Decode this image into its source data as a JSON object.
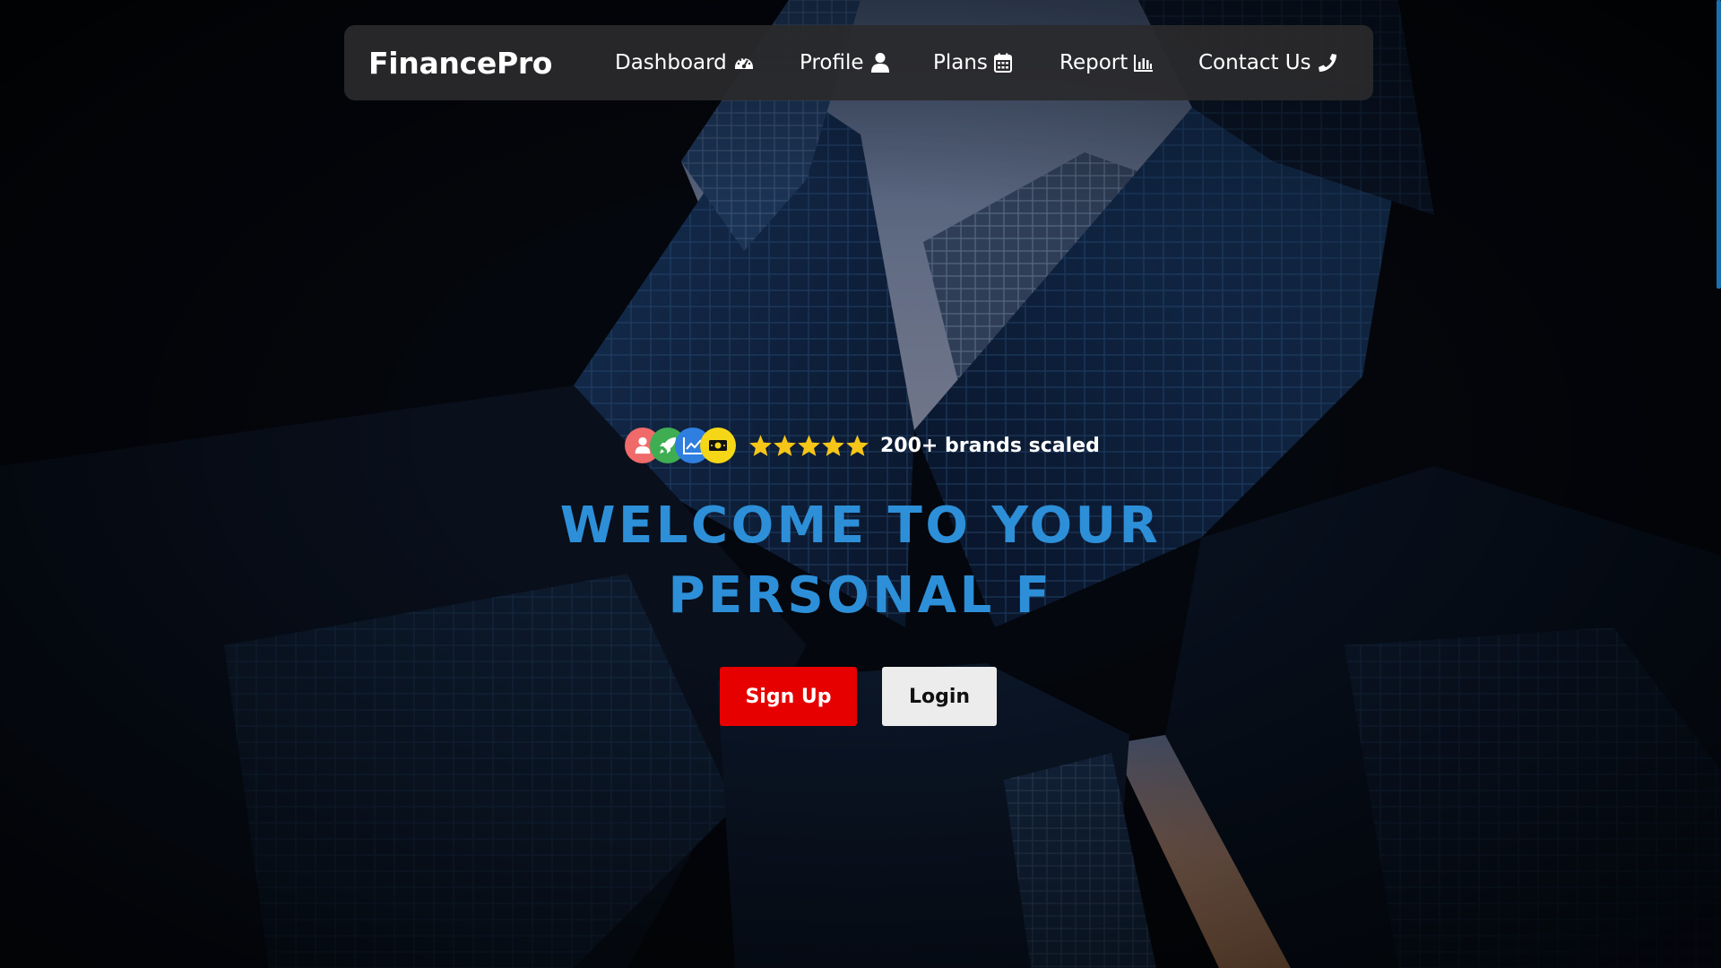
{
  "brand": "FinancePro",
  "nav": [
    {
      "label": "Dashboard",
      "icon": "gauge-icon"
    },
    {
      "label": "Profile",
      "icon": "user-icon"
    },
    {
      "label": "Plans",
      "icon": "calendar-icon"
    },
    {
      "label": "Report",
      "icon": "bar-chart-icon"
    },
    {
      "label": "Contact Us",
      "icon": "phone-icon"
    }
  ],
  "hero": {
    "avatars": [
      {
        "icon": "user-icon",
        "color": "#f06a6a"
      },
      {
        "icon": "rocket-icon",
        "color": "#3fae52"
      },
      {
        "icon": "chart-line-icon",
        "color": "#2f7fe0"
      },
      {
        "icon": "money-icon",
        "color": "#f5d718"
      }
    ],
    "rating": 5,
    "social_proof": "200+ brands scaled",
    "title": "WELCOME TO YOUR PERSONAL F"
  },
  "buttons": {
    "signup": "Sign Up",
    "login": "Login"
  },
  "colors": {
    "accent": "#2d8fd8",
    "signup": "#e60000",
    "star": "#f5c518",
    "nav_bg": "#2a2a2c"
  }
}
